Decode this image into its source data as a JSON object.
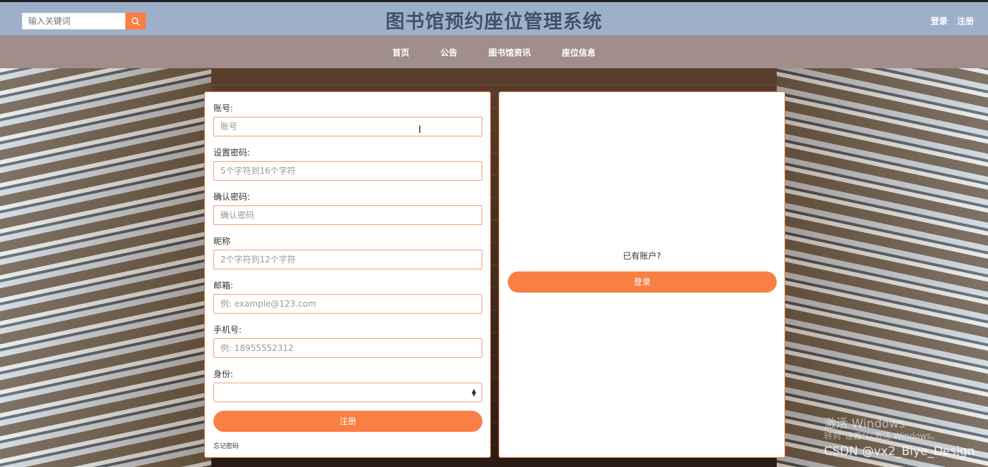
{
  "header": {
    "search_placeholder": "输入关键词",
    "title": "图书馆预约座位管理系统",
    "links": [
      "登录",
      "注册"
    ]
  },
  "nav": {
    "items": [
      "首页",
      "公告",
      "图书馆资讯",
      "座位信息"
    ]
  },
  "register_form": {
    "fields": [
      {
        "label": "账号:",
        "placeholder": "账号"
      },
      {
        "label": "设置密码:",
        "placeholder": "5个字符到16个字符"
      },
      {
        "label": "确认密码:",
        "placeholder": "确认密码"
      },
      {
        "label": "昵称",
        "placeholder": "2个字符到12个字符"
      },
      {
        "label": "邮箱:",
        "placeholder": "例: example@123.com"
      },
      {
        "label": "手机号:",
        "placeholder": "例: 18955552312"
      }
    ],
    "identity_label": "身份:",
    "identity_value": "",
    "submit_label": "注册",
    "forgot_label": "忘记密码"
  },
  "login_panel": {
    "prompt": "已有账户?",
    "button_label": "登录"
  },
  "overlay": {
    "activate_title": "激活 Windows",
    "activate_sub": "转到\"设置\"以激活 Windows。",
    "credit": "CSDN @vx2_Biye_Design"
  },
  "colors": {
    "accent": "#f97f44",
    "header_bg": "#9eafca",
    "nav_bg": "#a18d8a",
    "title": "#3f4f6d"
  }
}
